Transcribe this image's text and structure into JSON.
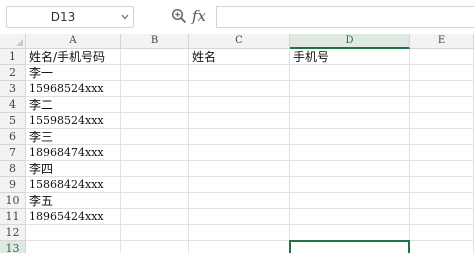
{
  "formula_bar": {
    "name_box_value": "D13",
    "fx_label": "fx",
    "formula_value": ""
  },
  "columns": [
    "A",
    "B",
    "C",
    "D",
    "E"
  ],
  "active_column": "D",
  "rows": [
    "1",
    "2",
    "3",
    "4",
    "5",
    "6",
    "7",
    "8",
    "9",
    "10",
    "11",
    "12",
    "13"
  ],
  "active_row": "13",
  "cells": {
    "A1": "姓名/手机号码",
    "C1": "姓名",
    "D1": "手机号",
    "A2": "李一",
    "A3": "15968524xxx",
    "A4": "李二",
    "A5": "15598524xxx",
    "A6": "李三",
    "A7": "18968474xxx",
    "A8": "李四",
    "A9": "15868424xxx",
    "A10": "李五",
    "A11": "18965424xxx"
  },
  "colors": {
    "accent_green": "#217346",
    "header_bg": "#f3f3f3",
    "active_header_bg": "#dfe9e2",
    "gridline": "#e1e1e1"
  },
  "icons": {
    "zoom": "zoom-formula-icon",
    "fx": "insert-function-icon",
    "dropdown": "chevron-down-icon"
  }
}
